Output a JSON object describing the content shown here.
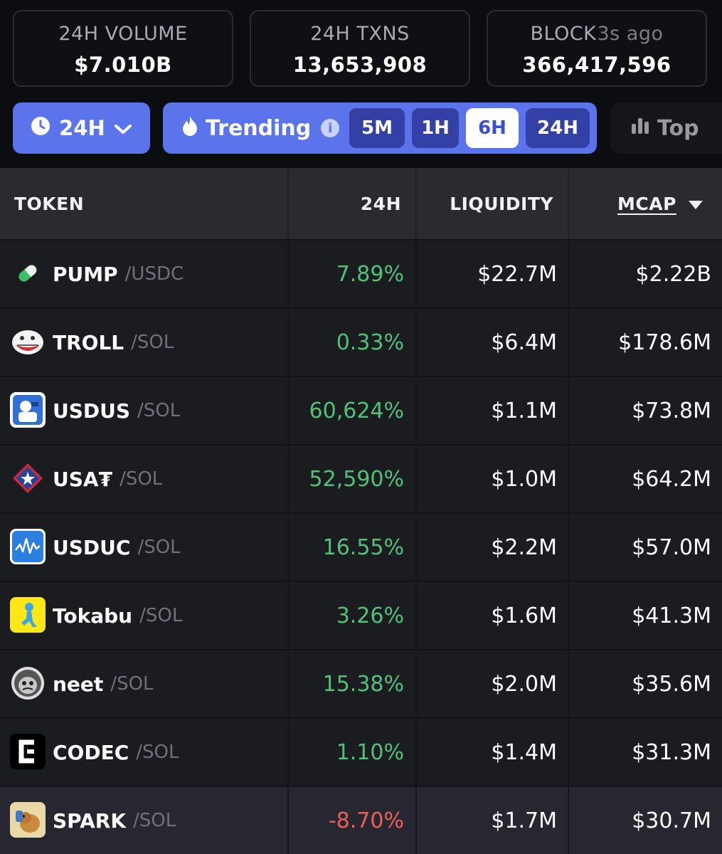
{
  "stats": [
    {
      "label": "24H VOLUME",
      "value": "$7.010B"
    },
    {
      "label": "24H TXNS",
      "value": "13,653,908"
    },
    {
      "label": "BLOCK",
      "overlay": "3s ago",
      "value": "366,417,596"
    }
  ],
  "controls": {
    "range_label": "24H",
    "trending_label": "Trending",
    "timeframes": [
      "5M",
      "1H",
      "6H",
      "24H"
    ],
    "active_timeframe": "6H",
    "top_label": "Top"
  },
  "table": {
    "headers": {
      "token": "TOKEN",
      "change": "24H",
      "liquidity": "LIQUIDITY",
      "mcap": "MCAP"
    },
    "rows": [
      {
        "name": "PUMP",
        "pair": "/USDC",
        "change": "7.89%",
        "liquidity": "$22.7M",
        "mcap": "$2.22B",
        "icon": "pill-icon"
      },
      {
        "name": "TROLL",
        "pair": "/SOL",
        "change": "0.33%",
        "liquidity": "$6.4M",
        "mcap": "$178.6M",
        "icon": "trollface-icon"
      },
      {
        "name": "USDUS",
        "pair": "/SOL",
        "change": "60,624%",
        "liquidity": "$1.1M",
        "mcap": "$73.8M",
        "icon": "usdus-icon"
      },
      {
        "name": "USA₮",
        "pair": "/SOL",
        "change": "52,590%",
        "liquidity": "$1.0M",
        "mcap": "$64.2M",
        "icon": "star-shield-icon"
      },
      {
        "name": "USDUC",
        "pair": "/SOL",
        "change": "16.55%",
        "liquidity": "$2.2M",
        "mcap": "$57.0M",
        "icon": "wave-chart-icon"
      },
      {
        "name": "Tokabu",
        "pair": "/SOL",
        "change": "3.26%",
        "liquidity": "$1.6M",
        "mcap": "$41.3M",
        "icon": "tokabu-icon"
      },
      {
        "name": "neet",
        "pair": "/SOL",
        "change": "15.38%",
        "liquidity": "$2.0M",
        "mcap": "$35.6M",
        "icon": "neet-face-icon"
      },
      {
        "name": "CODEC",
        "pair": "/SOL",
        "change": "1.10%",
        "liquidity": "$1.4M",
        "mcap": "$31.3M",
        "icon": "codec-icon"
      },
      {
        "name": "SPARK",
        "pair": "/SOL",
        "change": "-8.70%",
        "liquidity": "$1.7M",
        "mcap": "$30.7M",
        "icon": "spark-dog-icon"
      }
    ]
  },
  "colors": {
    "accent": "#5b74ec",
    "positive": "#4fc27a",
    "negative": "#ef5d5d"
  }
}
